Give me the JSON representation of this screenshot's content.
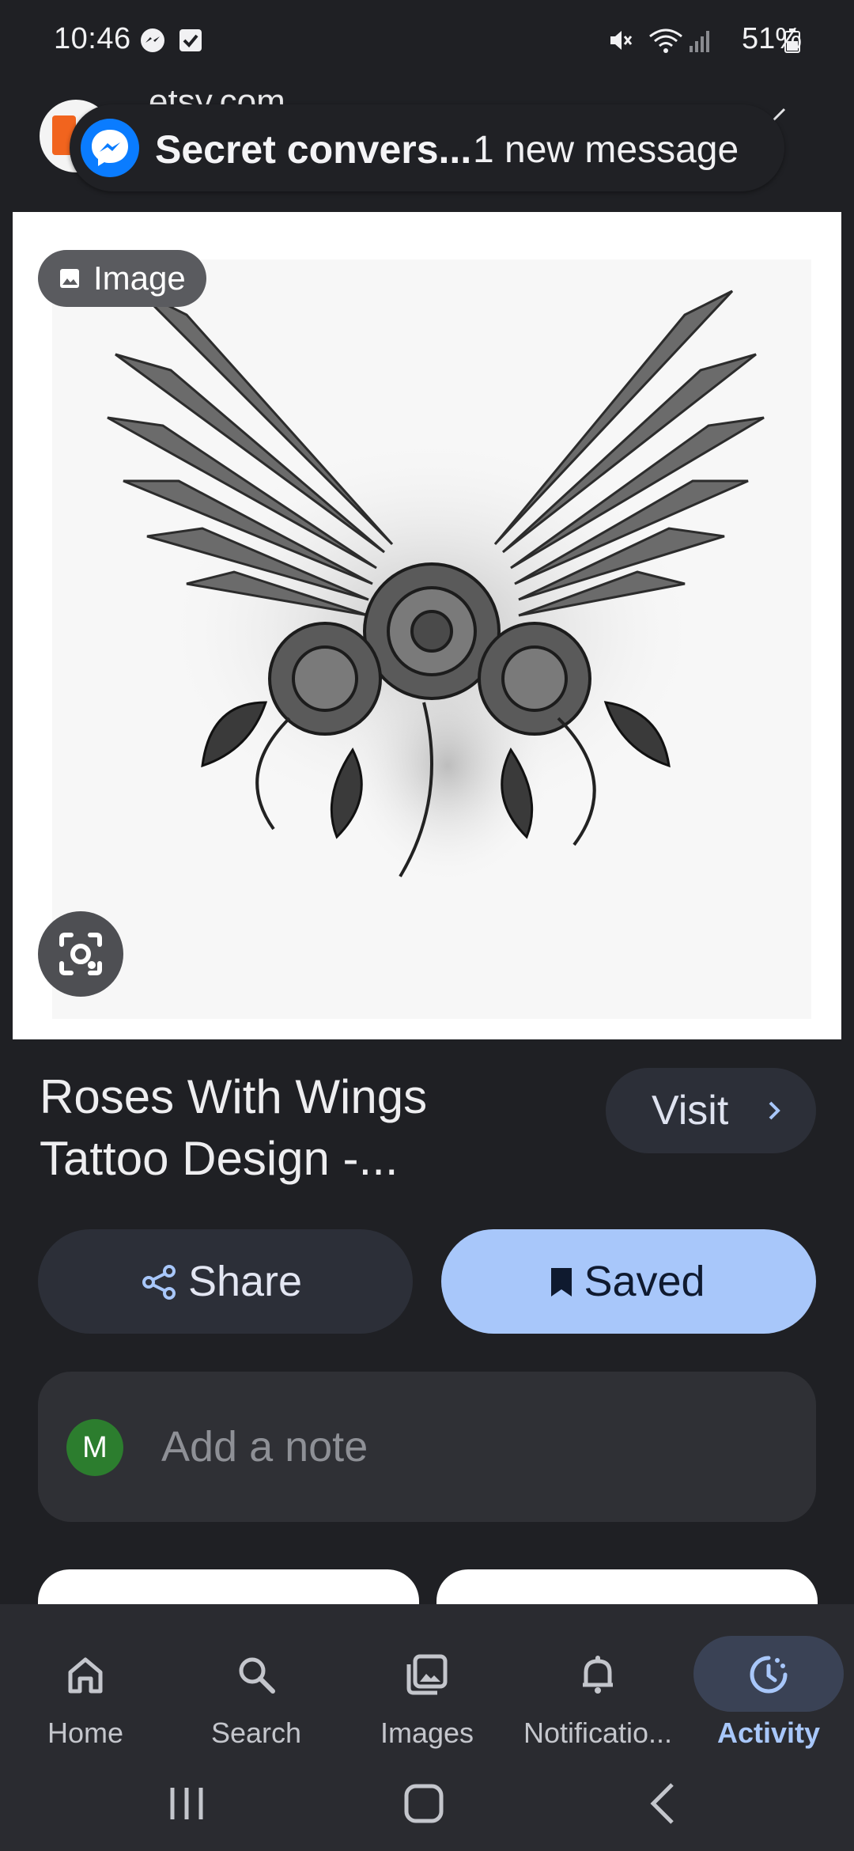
{
  "status_bar": {
    "time": "10:46",
    "battery": "51%",
    "icons": [
      "messenger-icon",
      "checkbox-icon",
      "mute-icon",
      "wifi-icon",
      "signal-icon",
      "battery-icon"
    ]
  },
  "header": {
    "site_domain": "etsy.com"
  },
  "bubble_notification": {
    "title": "Secret convers...",
    "subtitle": "1 new message"
  },
  "image_card": {
    "badge_label": "Image"
  },
  "result": {
    "title_line1": "Roses With Wings",
    "title_line2": "Tattoo Design -...",
    "visit_label": "Visit"
  },
  "actions": {
    "share_label": "Share",
    "saved_label": "Saved"
  },
  "note": {
    "avatar_letter": "M",
    "placeholder": "Add a note"
  },
  "bottom_nav": {
    "items": [
      {
        "label": "Home",
        "icon": "home-icon",
        "active": false
      },
      {
        "label": "Search",
        "icon": "search-icon",
        "active": false
      },
      {
        "label": "Images",
        "icon": "images-icon",
        "active": false
      },
      {
        "label": "Notificatio...",
        "icon": "bell-icon",
        "active": false
      },
      {
        "label": "Activity",
        "icon": "activity-icon",
        "active": true
      }
    ]
  },
  "colors": {
    "background": "#1f2024",
    "accent": "#a8c7fa",
    "button_dark": "#2c2f38",
    "messenger_blue": "#0a7cff",
    "avatar_green": "#2c7d2e"
  }
}
